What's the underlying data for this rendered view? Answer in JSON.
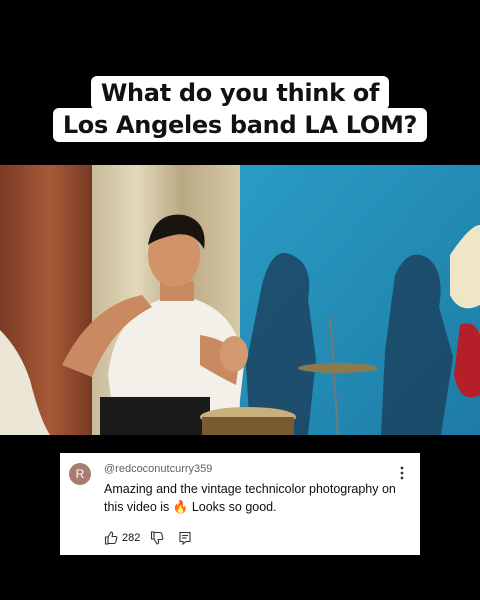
{
  "headline": {
    "line1": "What do you think of",
    "line2": "Los Angeles band LA LOM?"
  },
  "video": {
    "description_icon": "video-frame"
  },
  "comment": {
    "avatar_initial": "R",
    "avatar_color": "#a87c72",
    "username": "@redcoconutcurry359",
    "text": "Amazing and the vintage technicolor photography on this video is 🔥 Looks so good.",
    "likes": "282"
  },
  "colors": {
    "background": "#000000",
    "card": "#ffffff",
    "wall_blue": "#2c8cb0"
  }
}
